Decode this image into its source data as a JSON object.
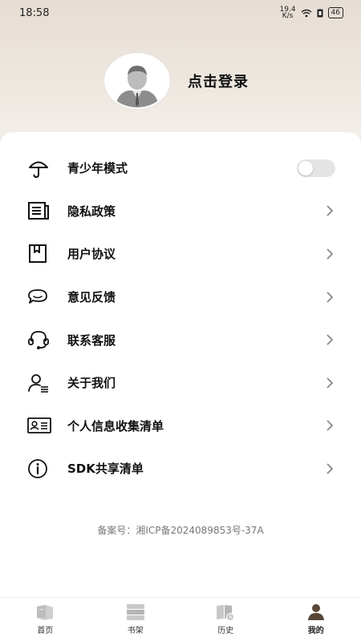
{
  "status_bar": {
    "time": "18:58",
    "net_speed_top": "19.4",
    "net_speed_unit": "K/s",
    "battery": "46"
  },
  "profile": {
    "login_label": "点击登录"
  },
  "menu": {
    "items": [
      {
        "label": "青少年模式",
        "icon": "umbrella-icon"
      },
      {
        "label": "隐私政策",
        "icon": "document-icon"
      },
      {
        "label": "用户协议",
        "icon": "bookmark-icon"
      },
      {
        "label": "意见反馈",
        "icon": "chat-bubble-icon"
      },
      {
        "label": "联系客服",
        "icon": "headset-icon"
      },
      {
        "label": "关于我们",
        "icon": "user-list-icon"
      },
      {
        "label": "个人信息收集清单",
        "icon": "id-card-icon"
      },
      {
        "label": "SDK共享清单",
        "icon": "info-icon"
      }
    ],
    "teen_mode_enabled": false
  },
  "footer": {
    "icp": "备案号：湘ICP备2024089853号-37A"
  },
  "tabbar": {
    "tabs": [
      {
        "label": "首页",
        "icon": "book-icon"
      },
      {
        "label": "书架",
        "icon": "bookshelf-icon"
      },
      {
        "label": "历史",
        "icon": "history-icon"
      },
      {
        "label": "我的",
        "icon": "person-icon"
      }
    ],
    "active": "我的"
  },
  "colors": {
    "accent": "#5a4636",
    "inactive_icon": "#c8c8c8",
    "chevron": "#888888"
  }
}
